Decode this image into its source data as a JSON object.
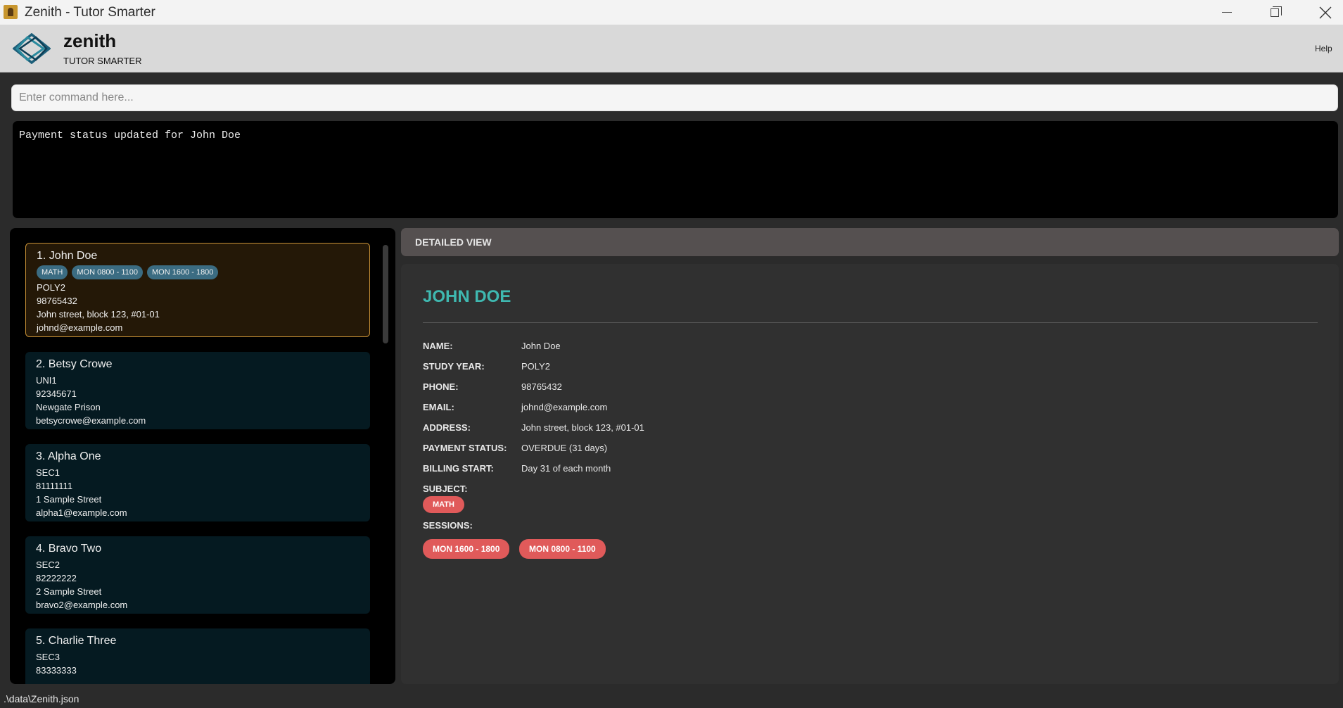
{
  "window": {
    "title": "Zenith - Tutor Smarter"
  },
  "header": {
    "brand_name": "zenith",
    "brand_tagline": "TUTOR SMARTER",
    "help_label": "Help"
  },
  "command": {
    "placeholder": "Enter command here...",
    "value": ""
  },
  "result": {
    "message": "Payment status updated for John Doe"
  },
  "students": [
    {
      "title": "1. John Doe",
      "tags": [
        "MATH",
        "MON 0800 - 1100",
        "MON 1600 - 1800"
      ],
      "year": "POLY2",
      "phone": "98765432",
      "address": "John street, block 123, #01-01",
      "email": "johnd@example.com"
    },
    {
      "title": "2. Betsy Crowe",
      "year": "UNI1",
      "phone": "92345671",
      "address": "Newgate Prison",
      "email": "betsycrowe@example.com"
    },
    {
      "title": "3. Alpha One",
      "year": "SEC1",
      "phone": "81111111",
      "address": "1 Sample Street",
      "email": "alpha1@example.com"
    },
    {
      "title": "4. Bravo Two",
      "year": "SEC2",
      "phone": "82222222",
      "address": "2 Sample Street",
      "email": "bravo2@example.com"
    },
    {
      "title": "5. Charlie Three",
      "year": "SEC3",
      "phone": "83333333"
    }
  ],
  "detail": {
    "header": "DETAILED VIEW",
    "name_heading": "JOHN DOE",
    "fields": [
      {
        "label": "NAME:",
        "value": "John Doe"
      },
      {
        "label": "STUDY YEAR:",
        "value": "POLY2"
      },
      {
        "label": "PHONE:",
        "value": "98765432"
      },
      {
        "label": "EMAIL:",
        "value": "johnd@example.com"
      },
      {
        "label": "ADDRESS:",
        "value": "John street, block 123, #01-01"
      },
      {
        "label": "PAYMENT STATUS:",
        "value": "OVERDUE (31 days)"
      },
      {
        "label": "BILLING START:",
        "value": "Day 31 of each month"
      }
    ],
    "subject_label": "SUBJECT:",
    "subjects": [
      "MATH"
    ],
    "sessions_label": "SESSIONS:",
    "sessions": [
      "MON 1600 - 1800",
      "MON 0800 - 1100"
    ]
  },
  "status": {
    "file_path": ".\\data\\Zenith.json"
  },
  "colors": {
    "accent_teal": "#3fb8b0",
    "pill_red": "#e05a5a",
    "tag_blue": "#3b6c82",
    "selected_border": "#c89136"
  }
}
